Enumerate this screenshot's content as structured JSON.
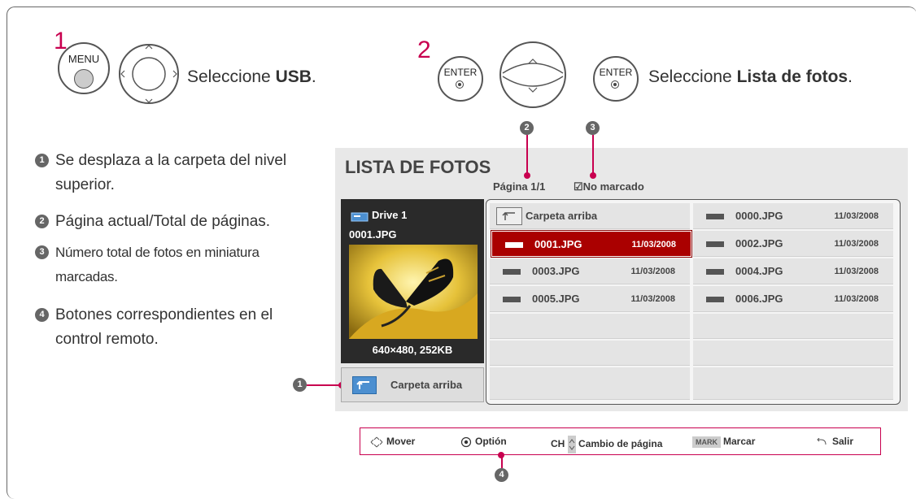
{
  "step1": {
    "number": "1",
    "menu_label": "MENU",
    "instruction_prefix": "Seleccione ",
    "instruction_bold": "USB",
    "instruction_suffix": "."
  },
  "step2": {
    "number": "2",
    "enter_label": "ENTER",
    "instruction_prefix": "Seleccione ",
    "instruction_bold": "Lista de fotos",
    "instruction_suffix": "."
  },
  "callouts": {
    "n1": "1",
    "n2": "2",
    "n3": "3",
    "n4": "4"
  },
  "legend": [
    {
      "num": "1",
      "text": "Se desplaza a la carpeta del nivel superior."
    },
    {
      "num": "2",
      "text": "Página actual/Total de páginas."
    },
    {
      "num": "3",
      "text": "Número total de fotos en miniatura marcadas."
    },
    {
      "num": "4",
      "text": "Botones correspondientes en el control remoto."
    }
  ],
  "screen": {
    "title": "LISTA DE FOTOS",
    "page_label": "Página 1/1",
    "marked_label": "☑No marcado",
    "preview": {
      "drive": "Drive 1",
      "filename": "0001.JPG",
      "dims": "640×480, 252KB"
    },
    "up_button": "Carpeta arriba"
  },
  "files": [
    {
      "name": "Carpeta arriba",
      "date": ""
    },
    {
      "name": "0000.JPG",
      "date": "11/03/2008"
    },
    {
      "name": "0001.JPG",
      "date": "11/03/2008"
    },
    {
      "name": "0002.JPG",
      "date": "11/03/2008"
    },
    {
      "name": "0003.JPG",
      "date": "11/03/2008"
    },
    {
      "name": "0004.JPG",
      "date": "11/03/2008"
    },
    {
      "name": "0005.JPG",
      "date": "11/03/2008"
    },
    {
      "name": "0006.JPG",
      "date": "11/03/2008"
    }
  ],
  "bottom_bar": {
    "move": "Mover",
    "option": "Optión",
    "ch": "CH",
    "page_change": "Cambio de página",
    "mark_badge": "MARK",
    "mark": "Marcar",
    "exit": "Salir"
  },
  "colors": {
    "accent": "#c8004f",
    "selected": "#aa0000"
  }
}
